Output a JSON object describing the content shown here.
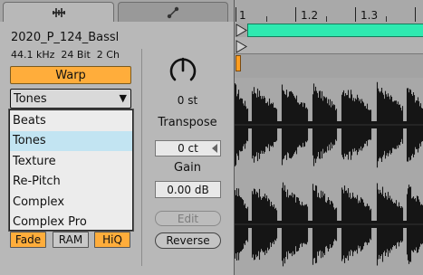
{
  "tabs": [
    {
      "name": "sample-tab",
      "icon": "waveform-icon",
      "active": true
    },
    {
      "name": "envelope-tab",
      "icon": "envelope-icon",
      "active": false
    }
  ],
  "sample": {
    "name": "2020_P_124_Bassl",
    "info": "44.1 kHz  24 Bit  2 Ch"
  },
  "warp": {
    "label": "Warp",
    "mode_selected": "Tones",
    "mode_options": [
      "Beats",
      "Tones",
      "Texture",
      "Re-Pitch",
      "Complex",
      "Complex Pro"
    ]
  },
  "toggles": {
    "fade": "Fade",
    "ram": "RAM",
    "hiq": "HiQ"
  },
  "transpose": {
    "value": "0 st",
    "label": "Transpose",
    "detune": "0 ct"
  },
  "gain": {
    "label": "Gain",
    "value": "0.00 dB"
  },
  "buttons": {
    "edit": "Edit",
    "reverse": "Reverse"
  },
  "ruler": {
    "labels": [
      "1",
      "1.2",
      "1.3"
    ]
  },
  "colors": {
    "accent_orange": "#ffad3b",
    "loop_green": "#2ee9b0",
    "selection_blue": "#c2e4f2"
  }
}
